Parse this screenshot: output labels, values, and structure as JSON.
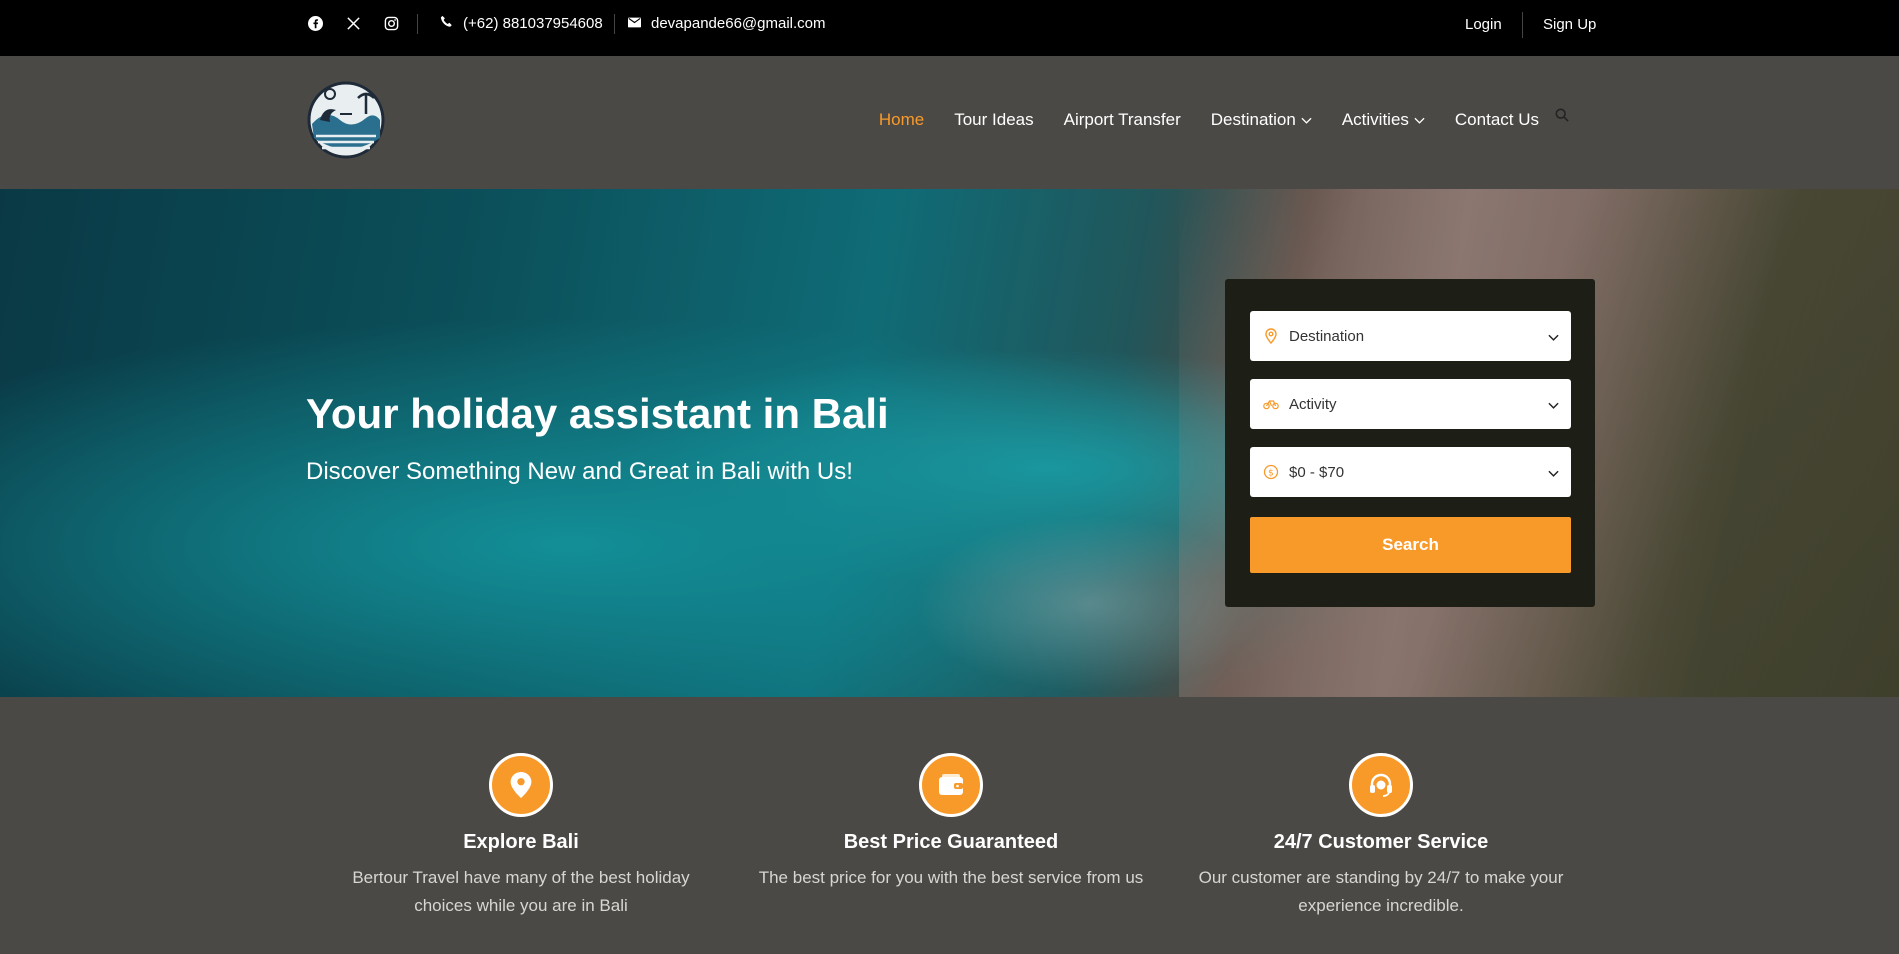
{
  "topbar": {
    "social": [
      "facebook-icon",
      "x-twitter-icon",
      "instagram-icon"
    ],
    "phone": "(+62) 881037954608",
    "email": "devapande66@gmail.com",
    "login": "Login",
    "signup": "Sign Up"
  },
  "nav": {
    "items": [
      {
        "label": "Home",
        "active": true
      },
      {
        "label": "Tour Ideas"
      },
      {
        "label": "Airport Transfer"
      },
      {
        "label": "Destination",
        "dropdown": true
      },
      {
        "label": "Activities",
        "dropdown": true
      },
      {
        "label": "Contact Us"
      }
    ]
  },
  "hero": {
    "title": "Your holiday assistant in Bali",
    "subtitle": "Discover Something New and Great in Bali with Us!"
  },
  "search": {
    "destination": "Destination",
    "activity": "Activity",
    "price": "$0 - $70",
    "button": "Search"
  },
  "features": [
    {
      "icon": "map-pin-icon",
      "title": "Explore Bali",
      "text_line1": "Bertour Travel have many of the best holiday",
      "text_line2": "choices while you are in Bali"
    },
    {
      "icon": "wallet-icon",
      "title": "Best Price Guaranteed",
      "text_line1": "The best price for you with the best service from us",
      "text_line2": ""
    },
    {
      "icon": "headset-icon",
      "title": "24/7 Customer Service",
      "text_line1": "Our customer are standing by 24/7 to make your",
      "text_line2": "experience incredible."
    }
  ],
  "colors": {
    "accent": "#f89a2a",
    "topbar": "#000000",
    "nav": "#4b4946",
    "card": "#1d1e15"
  }
}
